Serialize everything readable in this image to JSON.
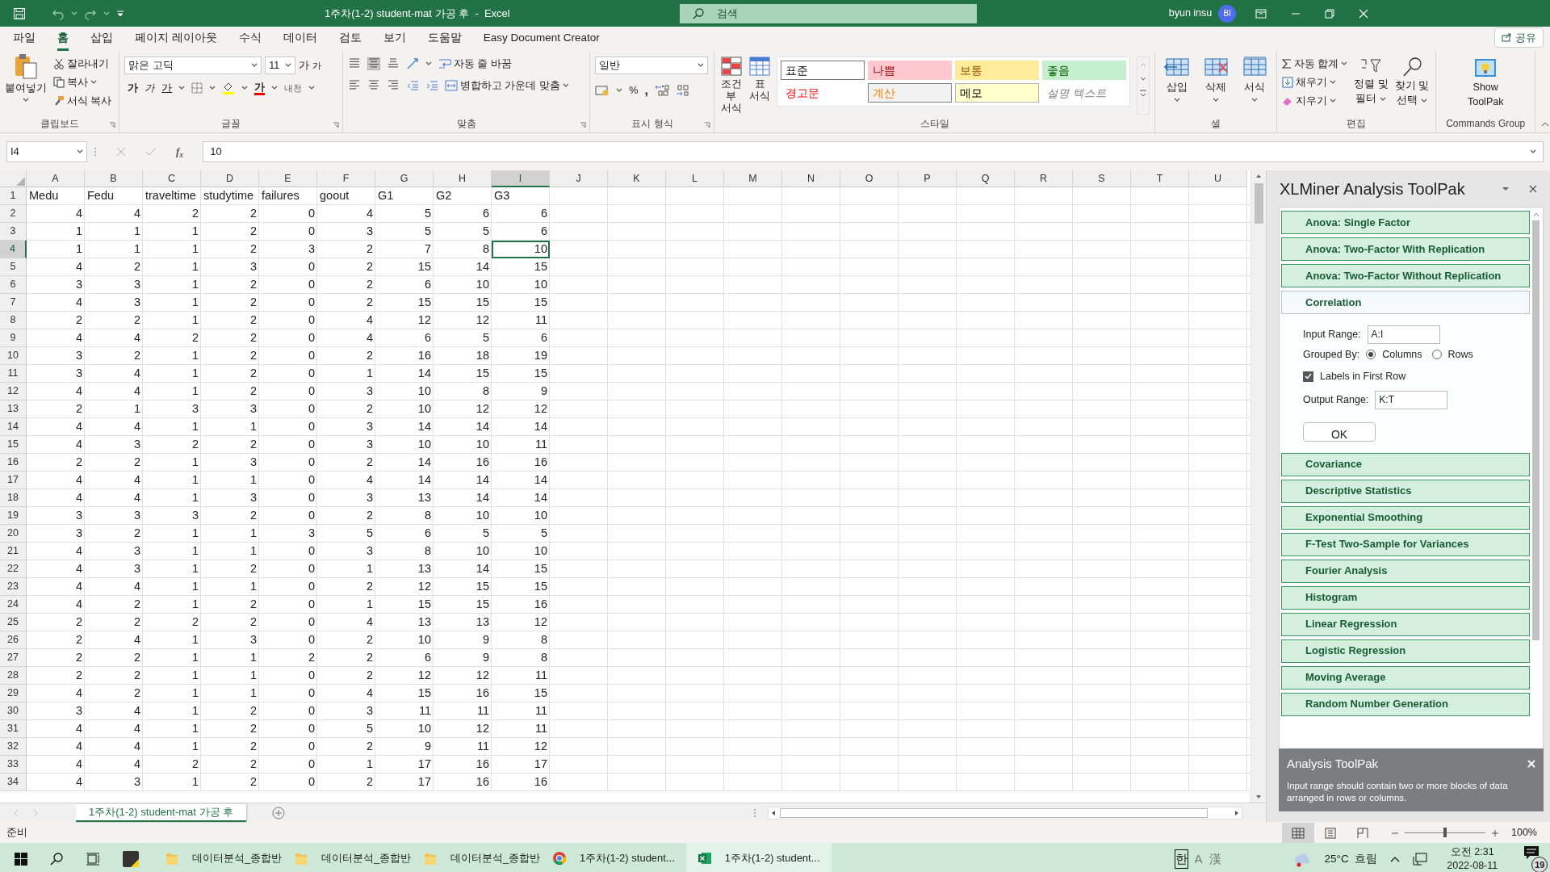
{
  "title_bar": {
    "title": "1주차(1-2) student-mat 가공 후  -  Excel",
    "search_placeholder": "검색",
    "user": "byun insu",
    "avatar": "BI"
  },
  "ribbon_tabs": [
    {
      "label": "파일",
      "selected": false
    },
    {
      "label": "홈",
      "selected": true
    },
    {
      "label": "삽입",
      "selected": false
    },
    {
      "label": "페이지 레이아웃",
      "selected": false
    },
    {
      "label": "수식",
      "selected": false
    },
    {
      "label": "데이터",
      "selected": false
    },
    {
      "label": "검토",
      "selected": false
    },
    {
      "label": "보기",
      "selected": false
    },
    {
      "label": "도움말",
      "selected": false
    },
    {
      "label": "Easy Document Creator",
      "selected": false
    }
  ],
  "share_button": "공유",
  "clipboard": {
    "label": "클립보드",
    "paste": "붙여넣기",
    "cut": "잘라내기",
    "copy": "복사",
    "format_painter": "서식 복사"
  },
  "font": {
    "label": "글꼴",
    "font_name": "맑은 고딕",
    "font_size": "11",
    "grow": "가",
    "shrink": "가",
    "bold": "가",
    "italic": "가",
    "underline": "가",
    "font_color": "가",
    "phonetic": "내천"
  },
  "alignment": {
    "label": "맞춤",
    "wrap_text": "자동 줄 바꿈",
    "merge": "병합하고 가운데 맞춤"
  },
  "number": {
    "label": "표시 형식",
    "format": "일반",
    "percent": "%",
    "comma": ","
  },
  "styles": {
    "label": "스타일",
    "conditional": "조건부 서식",
    "table": "표 서식",
    "gallery": [
      {
        "label": "표준",
        "kind": "normal"
      },
      {
        "label": "나쁨",
        "kind": "bad"
      },
      {
        "label": "보통",
        "kind": "neutral"
      },
      {
        "label": "좋음",
        "kind": "good"
      },
      {
        "label": "경고문",
        "kind": "warning"
      },
      {
        "label": "계산",
        "kind": "calculation"
      },
      {
        "label": "메모",
        "kind": "note"
      },
      {
        "label": "설명 텍스트",
        "kind": "explanatory"
      }
    ]
  },
  "cells": {
    "label": "셀",
    "insert": "삽입",
    "delete": "삭제",
    "format": "서식"
  },
  "editing": {
    "label": "편집",
    "autosum": "자동 합계",
    "fill": "채우기",
    "clear": "지우기",
    "sort_line1": "정렬 및",
    "sort_line2": "필터",
    "find_line1": "찾기 및",
    "find_line2": "선택"
  },
  "commands": {
    "label": "Commands Group",
    "show_line1": "Show",
    "show_line2": "ToolPak"
  },
  "formula_bar": {
    "name_box": "I4",
    "function_label": "f$_{x}$",
    "value": "10"
  },
  "columns": [
    {
      "label": "A",
      "selected": false
    },
    {
      "label": "B",
      "selected": false
    },
    {
      "label": "C",
      "selected": false
    },
    {
      "label": "D",
      "selected": false
    },
    {
      "label": "E",
      "selected": false
    },
    {
      "label": "F",
      "selected": false
    },
    {
      "label": "G",
      "selected": false
    },
    {
      "label": "H",
      "selected": false
    },
    {
      "label": "I",
      "selected": true
    },
    {
      "label": "J",
      "selected": false
    },
    {
      "label": "K",
      "selected": false
    },
    {
      "label": "L",
      "selected": false
    },
    {
      "label": "M",
      "selected": false
    },
    {
      "label": "N",
      "selected": false
    },
    {
      "label": "O",
      "selected": false
    },
    {
      "label": "P",
      "selected": false
    },
    {
      "label": "Q",
      "selected": false
    },
    {
      "label": "R",
      "selected": false
    },
    {
      "label": "S",
      "selected": false
    },
    {
      "label": "T",
      "selected": false
    },
    {
      "label": "U",
      "selected": false
    }
  ],
  "rows": [
    {
      "label": "1",
      "selected": false,
      "kind": "labels",
      "cells": [
        "Medu",
        "Fedu",
        "traveltime",
        "studytime",
        "failures",
        "goout",
        "G1",
        "G2",
        "G3"
      ]
    },
    {
      "label": "2",
      "selected": false,
      "kind": "values",
      "cells": [
        "4",
        "4",
        "2",
        "2",
        "0",
        "4",
        "5",
        "6",
        "6"
      ]
    },
    {
      "label": "3",
      "selected": false,
      "kind": "values",
      "cells": [
        "1",
        "1",
        "1",
        "2",
        "0",
        "3",
        "5",
        "5",
        "6"
      ]
    },
    {
      "label": "4",
      "selected": true,
      "kind": "values",
      "cells": [
        "1",
        "1",
        "1",
        "2",
        "3",
        "2",
        "7",
        "8",
        "10"
      ]
    },
    {
      "label": "5",
      "selected": false,
      "kind": "values",
      "cells": [
        "4",
        "2",
        "1",
        "3",
        "0",
        "2",
        "15",
        "14",
        "15"
      ]
    },
    {
      "label": "6",
      "selected": false,
      "kind": "values",
      "cells": [
        "3",
        "3",
        "1",
        "2",
        "0",
        "2",
        "6",
        "10",
        "10"
      ]
    },
    {
      "label": "7",
      "selected": false,
      "kind": "values",
      "cells": [
        "4",
        "3",
        "1",
        "2",
        "0",
        "2",
        "15",
        "15",
        "15"
      ]
    },
    {
      "label": "8",
      "selected": false,
      "kind": "values",
      "cells": [
        "2",
        "2",
        "1",
        "2",
        "0",
        "4",
        "12",
        "12",
        "11"
      ]
    },
    {
      "label": "9",
      "selected": false,
      "kind": "values",
      "cells": [
        "4",
        "4",
        "2",
        "2",
        "0",
        "4",
        "6",
        "5",
        "6"
      ]
    },
    {
      "label": "10",
      "selected": false,
      "kind": "values",
      "cells": [
        "3",
        "2",
        "1",
        "2",
        "0",
        "2",
        "16",
        "18",
        "19"
      ]
    },
    {
      "label": "11",
      "selected": false,
      "kind": "values",
      "cells": [
        "3",
        "4",
        "1",
        "2",
        "0",
        "1",
        "14",
        "15",
        "15"
      ]
    },
    {
      "label": "12",
      "selected": false,
      "kind": "values",
      "cells": [
        "4",
        "4",
        "1",
        "2",
        "0",
        "3",
        "10",
        "8",
        "9"
      ]
    },
    {
      "label": "13",
      "selected": false,
      "kind": "values",
      "cells": [
        "2",
        "1",
        "3",
        "3",
        "0",
        "2",
        "10",
        "12",
        "12"
      ]
    },
    {
      "label": "14",
      "selected": false,
      "kind": "values",
      "cells": [
        "4",
        "4",
        "1",
        "1",
        "0",
        "3",
        "14",
        "14",
        "14"
      ]
    },
    {
      "label": "15",
      "selected": false,
      "kind": "values",
      "cells": [
        "4",
        "3",
        "2",
        "2",
        "0",
        "3",
        "10",
        "10",
        "11"
      ]
    },
    {
      "label": "16",
      "selected": false,
      "kind": "values",
      "cells": [
        "2",
        "2",
        "1",
        "3",
        "0",
        "2",
        "14",
        "16",
        "16"
      ]
    },
    {
      "label": "17",
      "selected": false,
      "kind": "values",
      "cells": [
        "4",
        "4",
        "1",
        "1",
        "0",
        "4",
        "14",
        "14",
        "14"
      ]
    },
    {
      "label": "18",
      "selected": false,
      "kind": "values",
      "cells": [
        "4",
        "4",
        "1",
        "3",
        "0",
        "3",
        "13",
        "14",
        "14"
      ]
    },
    {
      "label": "19",
      "selected": false,
      "kind": "values",
      "cells": [
        "3",
        "3",
        "3",
        "2",
        "0",
        "2",
        "8",
        "10",
        "10"
      ]
    },
    {
      "label": "20",
      "selected": false,
      "kind": "values",
      "cells": [
        "3",
        "2",
        "1",
        "1",
        "3",
        "5",
        "6",
        "5",
        "5"
      ]
    },
    {
      "label": "21",
      "selected": false,
      "kind": "values",
      "cells": [
        "4",
        "3",
        "1",
        "1",
        "0",
        "3",
        "8",
        "10",
        "10"
      ]
    },
    {
      "label": "22",
      "selected": false,
      "kind": "values",
      "cells": [
        "4",
        "3",
        "1",
        "2",
        "0",
        "1",
        "13",
        "14",
        "15"
      ]
    },
    {
      "label": "23",
      "selected": false,
      "kind": "values",
      "cells": [
        "4",
        "4",
        "1",
        "1",
        "0",
        "2",
        "12",
        "15",
        "15"
      ]
    },
    {
      "label": "24",
      "selected": false,
      "kind": "values",
      "cells": [
        "4",
        "2",
        "1",
        "2",
        "0",
        "1",
        "15",
        "15",
        "16"
      ]
    },
    {
      "label": "25",
      "selected": false,
      "kind": "values",
      "cells": [
        "2",
        "2",
        "2",
        "2",
        "0",
        "4",
        "13",
        "13",
        "12"
      ]
    },
    {
      "label": "26",
      "selected": false,
      "kind": "values",
      "cells": [
        "2",
        "4",
        "1",
        "3",
        "0",
        "2",
        "10",
        "9",
        "8"
      ]
    },
    {
      "label": "27",
      "selected": false,
      "kind": "values",
      "cells": [
        "2",
        "2",
        "1",
        "1",
        "2",
        "2",
        "6",
        "9",
        "8"
      ]
    },
    {
      "label": "28",
      "selected": false,
      "kind": "values",
      "cells": [
        "2",
        "2",
        "1",
        "1",
        "0",
        "2",
        "12",
        "12",
        "11"
      ]
    },
    {
      "label": "29",
      "selected": false,
      "kind": "values",
      "cells": [
        "4",
        "2",
        "1",
        "1",
        "0",
        "4",
        "15",
        "16",
        "15"
      ]
    },
    {
      "label": "30",
      "selected": false,
      "kind": "values",
      "cells": [
        "3",
        "4",
        "1",
        "2",
        "0",
        "3",
        "11",
        "11",
        "11"
      ]
    },
    {
      "label": "31",
      "selected": false,
      "kind": "values",
      "cells": [
        "4",
        "4",
        "1",
        "2",
        "0",
        "5",
        "10",
        "12",
        "11"
      ]
    },
    {
      "label": "32",
      "selected": false,
      "kind": "values",
      "cells": [
        "4",
        "4",
        "1",
        "2",
        "0",
        "2",
        "9",
        "11",
        "12"
      ]
    },
    {
      "label": "33",
      "selected": false,
      "kind": "values",
      "cells": [
        "4",
        "4",
        "2",
        "2",
        "0",
        "1",
        "17",
        "16",
        "17"
      ]
    },
    {
      "label": "34",
      "selected": false,
      "kind": "values",
      "cells": [
        "4",
        "3",
        "1",
        "2",
        "0",
        "2",
        "17",
        "16",
        "16"
      ]
    }
  ],
  "sheet_tabs": [
    {
      "label": "1주차(1-2) student-mat 가공 후",
      "selected": true
    }
  ],
  "task_pane": {
    "title": "XLMiner Analysis ToolPak",
    "tools": [
      {
        "label": "Anova: Single Factor",
        "expanded": false
      },
      {
        "label": "Anova: Two-Factor With Replication",
        "expanded": false
      },
      {
        "label": "Anova: Two-Factor Without Replication",
        "expanded": false
      },
      {
        "label": "Correlation",
        "expanded": true
      },
      {
        "label": "Covariance",
        "expanded": false
      },
      {
        "label": "Descriptive Statistics",
        "expanded": false
      },
      {
        "label": "Exponential Smoothing",
        "expanded": false
      },
      {
        "label": "F-Test Two-Sample for Variances",
        "expanded": false
      },
      {
        "label": "Fourier Analysis",
        "expanded": false
      },
      {
        "label": "Histogram",
        "expanded": false
      },
      {
        "label": "Linear Regression",
        "expanded": false
      },
      {
        "label": "Logistic Regression",
        "expanded": false
      },
      {
        "label": "Moving Average",
        "expanded": false
      },
      {
        "label": "Random Number Generation",
        "expanded": false
      }
    ],
    "form": {
      "input_label": "Input Range:",
      "input_value": "A:I",
      "grouped_label": "Grouped By:",
      "grouped_options": [
        {
          "label": "Columns",
          "selected": true
        },
        {
          "label": "Rows",
          "selected": false
        }
      ],
      "labels_first_row": {
        "label": "Labels in First Row",
        "checked": true
      },
      "output_label": "Output Range:",
      "output_value": "K:T",
      "ok": "OK"
    },
    "notification": {
      "title": "Analysis ToolPak",
      "message": "Input range should contain two or more blocks of data arranged in rows or columns."
    }
  },
  "status_bar": {
    "status": "준비",
    "views": [
      {
        "kind": "normal",
        "selected": true
      },
      {
        "kind": "page_layout",
        "selected": false
      },
      {
        "kind": "page_break",
        "selected": false
      }
    ],
    "zoom_level": {
      "level": 0.5
    },
    "zoom": "100%"
  },
  "taskbar": {
    "apps": [
      {
        "label": "데이터분석_종합반",
        "kind": "folder",
        "selected": false
      },
      {
        "label": "데이터분석_종합반",
        "kind": "folder",
        "selected": false
      },
      {
        "label": "데이터분석_종합반",
        "kind": "folder",
        "selected": false
      },
      {
        "label": "1주차(1-2) student...",
        "kind": "chrome",
        "selected": false
      },
      {
        "label": "1주차(1-2) student...",
        "kind": "excel",
        "selected": true
      }
    ],
    "ime": [
      "한",
      "A",
      "漢"
    ],
    "weather": "25°C  흐림",
    "time": "오전 2:31",
    "date": "2022-08-11",
    "notifications": "19"
  }
}
